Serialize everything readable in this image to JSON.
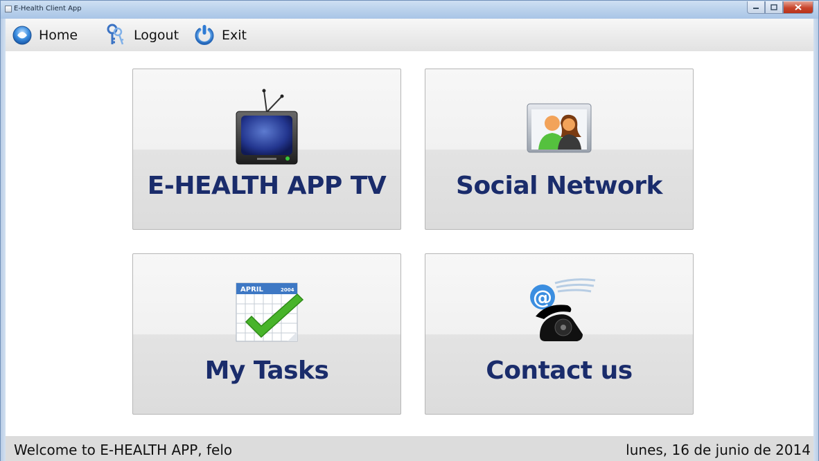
{
  "window": {
    "title": "E-Health Client App"
  },
  "menu": {
    "home": "Home",
    "logout": "Logout",
    "exit": "Exit"
  },
  "tiles": [
    {
      "label": "E-HEALTH APP TV",
      "icon": "television-icon"
    },
    {
      "label": "Social Network",
      "icon": "people-icon"
    },
    {
      "label": "My Tasks",
      "icon": "calendar-check-icon"
    },
    {
      "label": "Contact us",
      "icon": "telephone-at-icon"
    }
  ],
  "calendar_icon": {
    "month": "APRIL",
    "year": "2004"
  },
  "contact_icon": {
    "at": "@"
  },
  "status": {
    "welcome": "Welcome to E-HEALTH APP, felo",
    "date": "lunes, 16 de junio de 2014"
  },
  "colors": {
    "tile_text": "#1a2c6b",
    "titlebar": "#bcd3ec",
    "statusbar": "#dcdcdc"
  }
}
